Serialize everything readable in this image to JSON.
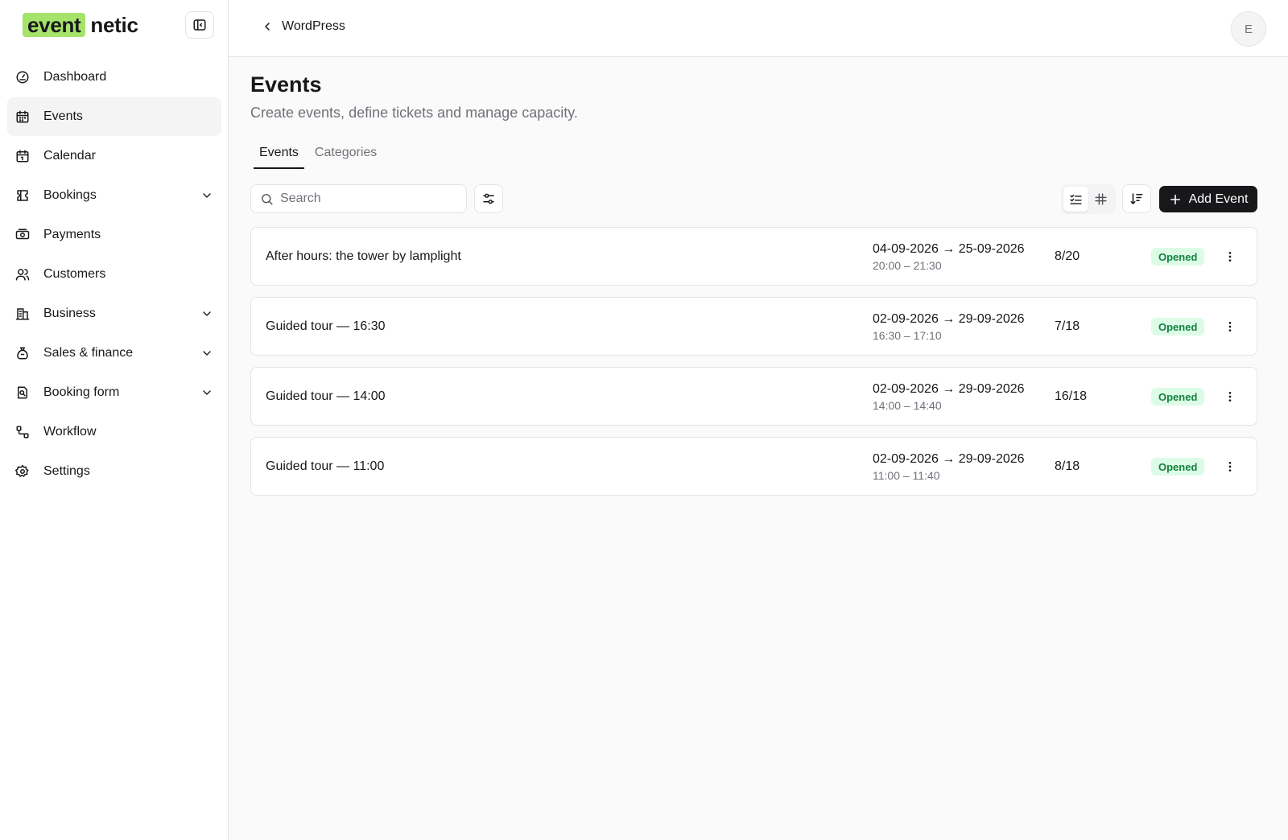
{
  "brand": {
    "highlight": "event",
    "rest": "netic"
  },
  "sidebar": {
    "items": [
      {
        "label": "Dashboard",
        "icon": "dashboard-icon",
        "active": false,
        "expandable": false
      },
      {
        "label": "Events",
        "icon": "calendar-grid-icon",
        "active": true,
        "expandable": false
      },
      {
        "label": "Calendar",
        "icon": "calendar-icon",
        "active": false,
        "expandable": false
      },
      {
        "label": "Bookings",
        "icon": "ticket-icon",
        "active": false,
        "expandable": true
      },
      {
        "label": "Payments",
        "icon": "money-icon",
        "active": false,
        "expandable": false
      },
      {
        "label": "Customers",
        "icon": "users-icon",
        "active": false,
        "expandable": false
      },
      {
        "label": "Business",
        "icon": "building-icon",
        "active": false,
        "expandable": true
      },
      {
        "label": "Sales & finance",
        "icon": "money-bag-icon",
        "active": false,
        "expandable": true
      },
      {
        "label": "Booking form",
        "icon": "form-icon",
        "active": false,
        "expandable": true
      },
      {
        "label": "Workflow",
        "icon": "workflow-icon",
        "active": false,
        "expandable": false
      },
      {
        "label": "Settings",
        "icon": "gear-icon",
        "active": false,
        "expandable": false
      }
    ]
  },
  "header": {
    "back_label": "WordPress",
    "avatar_initial": "E"
  },
  "main": {
    "title": "Events",
    "subtitle": "Create events, define tickets and manage capacity.",
    "tabs": [
      {
        "label": "Events",
        "active": true
      },
      {
        "label": "Categories",
        "active": false
      }
    ],
    "search": {
      "placeholder": "Search",
      "value": ""
    },
    "add_label": "Add Event",
    "events": [
      {
        "name": "After hours: the tower by lamplight",
        "dates": "04-09-2026 → 25-09-2026",
        "times": "20:00 – 21:30",
        "capacity": "8/20",
        "status": "Opened"
      },
      {
        "name": "Guided tour — 16:30",
        "dates": "02-09-2026 → 29-09-2026",
        "times": "16:30 – 17:10",
        "capacity": "7/18",
        "status": "Opened"
      },
      {
        "name": "Guided tour — 14:00",
        "dates": "02-09-2026 → 29-09-2026",
        "times": "14:00 – 14:40",
        "capacity": "16/18",
        "status": "Opened"
      },
      {
        "name": "Guided tour — 11:00",
        "dates": "02-09-2026 → 29-09-2026",
        "times": "11:00 – 11:40",
        "capacity": "8/18",
        "status": "Opened"
      }
    ]
  },
  "colors": {
    "brand_highlight": "#a6e36a",
    "status_open_bg": "#dcfce7",
    "status_open_fg": "#15803d",
    "primary": "#18181b"
  }
}
